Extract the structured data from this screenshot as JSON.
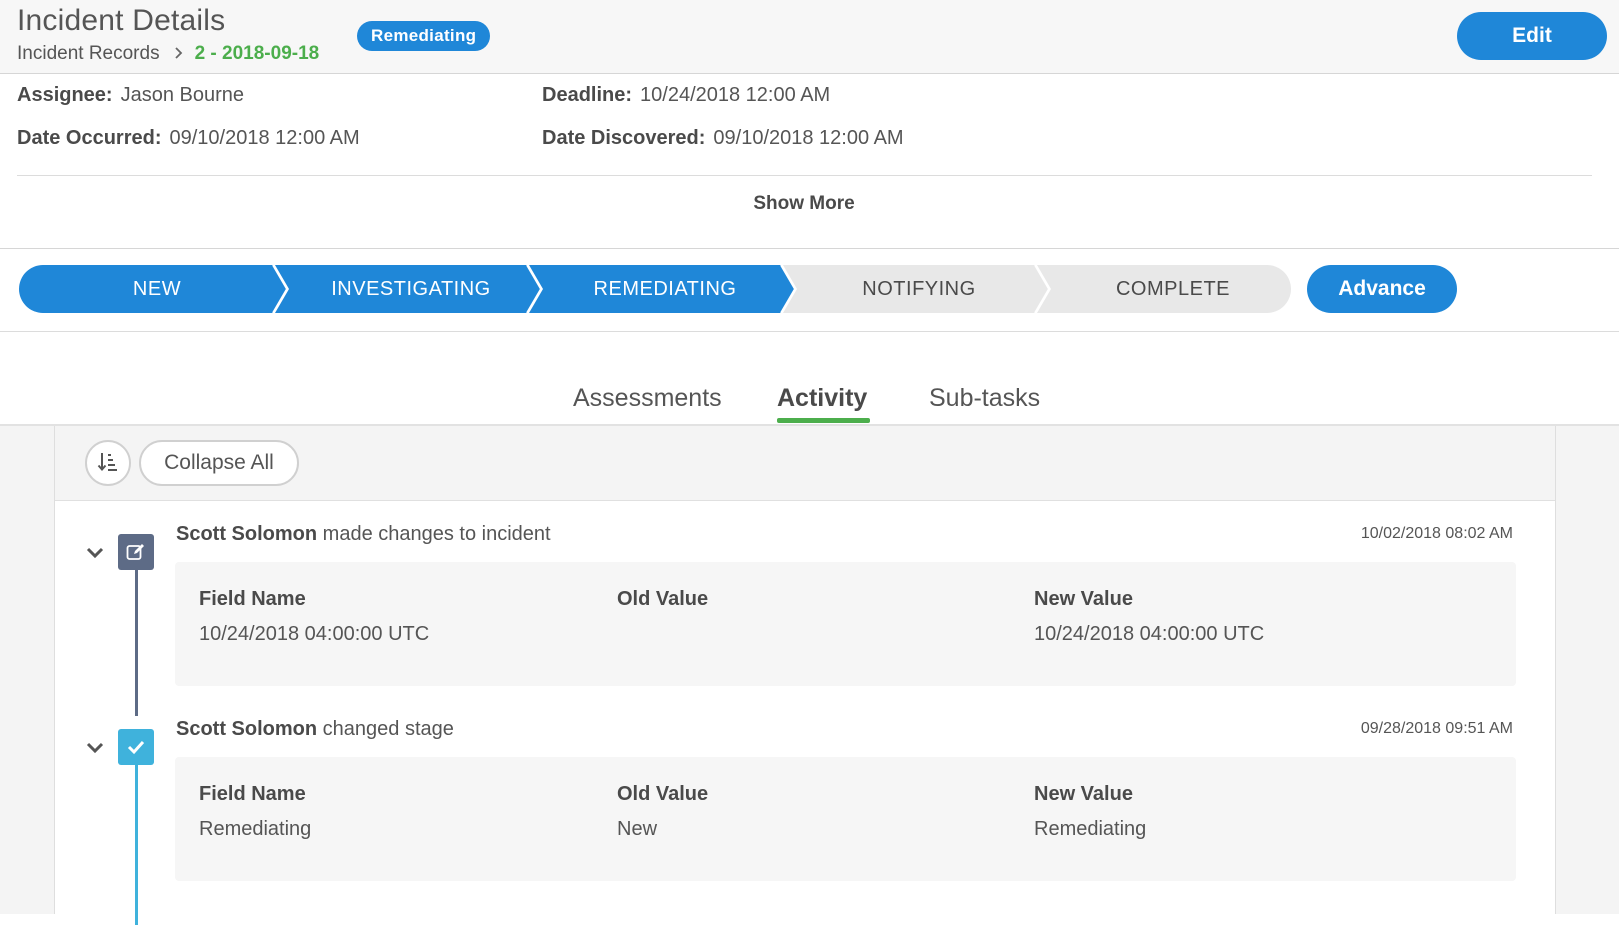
{
  "header": {
    "title": "Incident Details",
    "breadcrumb": {
      "parent": "Incident Records",
      "separator_icon": "chevron-right-icon",
      "current": "2 - 2018-09-18"
    },
    "status_badge": "Remediating",
    "edit_label": "Edit"
  },
  "details": {
    "assignee": {
      "label": "Assignee:",
      "value": "Jason Bourne"
    },
    "deadline": {
      "label": "Deadline:",
      "value": "10/24/2018 12:00 AM"
    },
    "date_occurred": {
      "label": "Date Occurred:",
      "value": "09/10/2018 12:00 AM"
    },
    "date_discovered": {
      "label": "Date Discovered:",
      "value": "09/10/2018 12:00 AM"
    },
    "show_more_label": "Show More"
  },
  "stages": {
    "items": [
      {
        "label": "NEW",
        "state": "done"
      },
      {
        "label": "INVESTIGATING",
        "state": "done"
      },
      {
        "label": "REMEDIATING",
        "state": "current"
      },
      {
        "label": "NOTIFYING",
        "state": "pending"
      },
      {
        "label": "COMPLETE",
        "state": "pending"
      }
    ],
    "advance_label": "Advance"
  },
  "tabs": {
    "items": [
      {
        "label": "Assessments",
        "active": false
      },
      {
        "label": "Activity",
        "active": true
      },
      {
        "label": "Sub-tasks",
        "active": false
      }
    ]
  },
  "activity": {
    "toolbar": {
      "sort_icon": "sort-order-icon",
      "collapse_all_label": "Collapse All"
    },
    "entries": [
      {
        "actor": "Scott Solomon",
        "action": "made changes to incident",
        "timestamp": "10/02/2018 08:02 AM",
        "icon": "edit-icon",
        "icon_color": "#5d6b86",
        "changes": {
          "headers": [
            "Field Name",
            "Old Value",
            "New Value"
          ],
          "row": [
            "10/24/2018 04:00:00 UTC",
            "",
            "10/24/2018 04:00:00 UTC"
          ]
        }
      },
      {
        "actor": "Scott Solomon",
        "action": "changed stage",
        "timestamp": "09/28/2018 09:51 AM",
        "icon": "checkmark-icon",
        "icon_color": "#3fb2dc",
        "changes": {
          "headers": [
            "Field Name",
            "Old Value",
            "New Value"
          ],
          "row": [
            "Remediating",
            "New",
            "Remediating"
          ]
        }
      }
    ]
  },
  "colors": {
    "primary_blue": "#1f87d8",
    "breadcrumb_green": "#4cae4c",
    "tab_active_underline": "#4cae4c",
    "pending_stage_grey": "#e8e8e8"
  }
}
